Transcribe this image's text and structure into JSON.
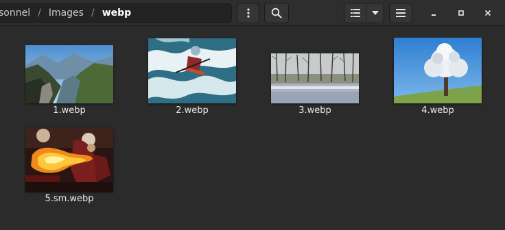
{
  "breadcrumb": {
    "segments": [
      "sonnel",
      "Images",
      "webp"
    ]
  },
  "header": {
    "menu_icon": "vertical-dots-icon",
    "search_icon": "search-icon",
    "view_icon": "list-view-icon",
    "dropdown_icon": "triangle-down-icon",
    "hamburger_icon": "hamburger-icon",
    "window_controls": [
      "minimize-icon",
      "maximize-icon",
      "close-icon"
    ]
  },
  "files": [
    {
      "name": "1.webp"
    },
    {
      "name": "2.webp"
    },
    {
      "name": "3.webp"
    },
    {
      "name": "4.webp"
    },
    {
      "name": "5.sm.webp"
    }
  ],
  "colors": {
    "background": "#2b2b2b",
    "header": "#2e2e2e",
    "text": "#eaeaea"
  }
}
